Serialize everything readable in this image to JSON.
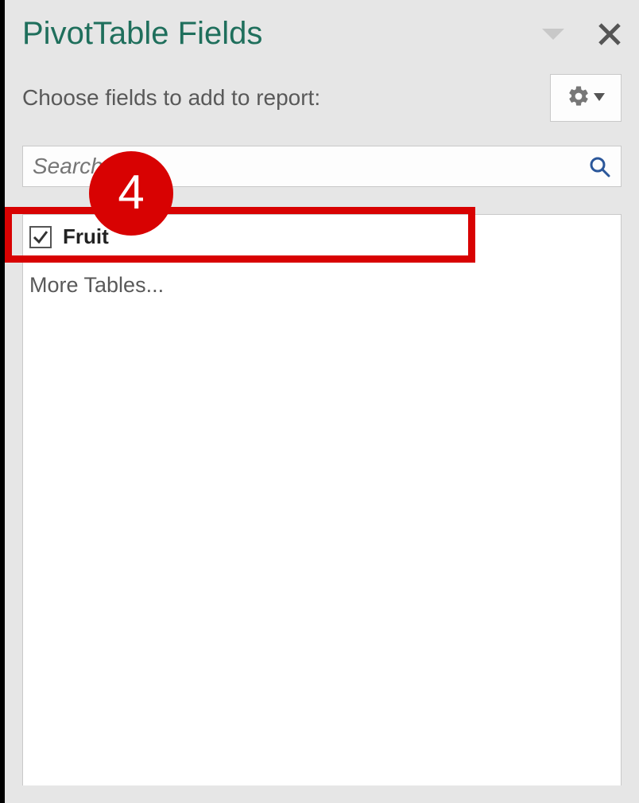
{
  "panel": {
    "title": "PivotTable Fields",
    "subtitle": "Choose fields to add to report:"
  },
  "search": {
    "placeholder": "Search"
  },
  "fields": {
    "item1": {
      "label": "Fruit",
      "checked": true
    },
    "more_label": "More Tables..."
  },
  "annotation": {
    "step_number": "4"
  }
}
